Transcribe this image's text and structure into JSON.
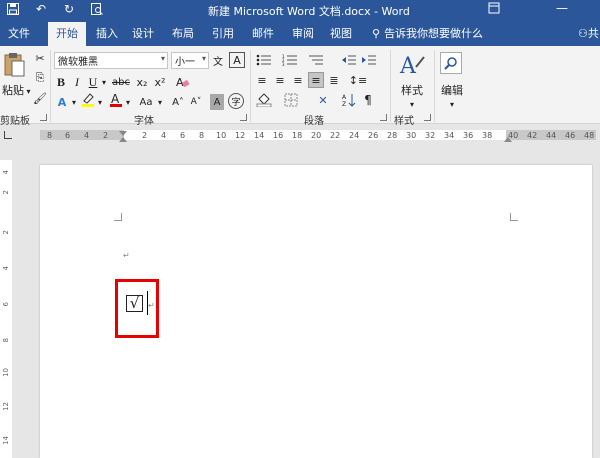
{
  "window": {
    "title": "新建 Microsoft Word 文档.docx - Word",
    "restore_icon": "restore-icon",
    "minimize_icon": "minimize-icon"
  },
  "qat": {
    "save_icon": "save-icon",
    "undo_icon": "undo-icon",
    "redo_icon": "redo-icon",
    "preview_icon": "print-preview-icon"
  },
  "tabs": [
    "文件",
    "开始",
    "插入",
    "设计",
    "布局",
    "引用",
    "邮件",
    "审阅",
    "视图"
  ],
  "active_tab": "开始",
  "tellme": "告诉我你想要做什么",
  "share_partial": "共",
  "ribbon": {
    "clipboard": {
      "paste_label": "粘贴",
      "group_label": "剪贴板"
    },
    "font": {
      "font_name": "微软雅黑",
      "font_size": "小一",
      "bold": "B",
      "italic": "I",
      "underline": "U",
      "strikethrough": "abc",
      "subscript": "x₂",
      "superscript": "x²",
      "font_color_letter": "A",
      "change_case": "Aa",
      "grow": "A˄",
      "shrink": "A˅",
      "char_shading": "A",
      "enclose": "字",
      "phonetic": "文",
      "clear_format": "A",
      "group_label": "字体",
      "highlight_color": "#ffff00",
      "font_color": "#e00000"
    },
    "paragraph": {
      "group_label": "段落"
    },
    "styles": {
      "button_label": "样式",
      "group_label": "样式"
    },
    "editing": {
      "button_label": "编辑"
    }
  },
  "hruler_numbers": [
    "8",
    "6",
    "4",
    "2",
    "2",
    "4",
    "6",
    "8",
    "10",
    "12",
    "14",
    "16",
    "18",
    "20",
    "22",
    "24",
    "26",
    "28",
    "30",
    "32",
    "34",
    "36",
    "38",
    "40",
    "42",
    "44",
    "46",
    "48"
  ],
  "vruler_numbers": [
    "4",
    "2",
    "2",
    "4",
    "6",
    "8",
    "10",
    "12",
    "14"
  ],
  "document": {
    "paragraph_mark": "↵",
    "checkbox_symbol": "√",
    "end_mark": "↵"
  },
  "colors": {
    "word_blue": "#2b579a",
    "highlight_border": "#e60000"
  }
}
